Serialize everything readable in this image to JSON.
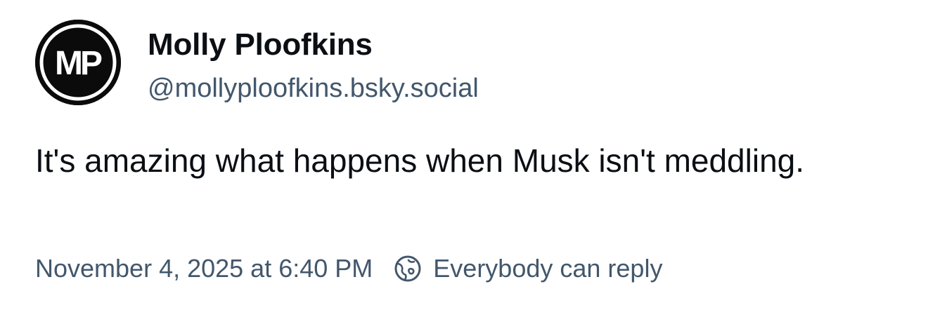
{
  "author": {
    "avatar_initials": "MP",
    "display_name": "Molly Ploofkins",
    "handle": "@mollyploofkins.bsky.social"
  },
  "post": {
    "text": "It's amazing what happens when Musk isn't meddling."
  },
  "meta": {
    "timestamp": "November 4, 2025 at 6:40 PM",
    "reply_setting_icon": "globe-icon",
    "reply_setting": "Everybody can reply"
  },
  "colors": {
    "text_primary": "#0b0f14",
    "text_secondary": "#42576c",
    "avatar_bg": "#0b0b0b",
    "background": "#ffffff"
  }
}
